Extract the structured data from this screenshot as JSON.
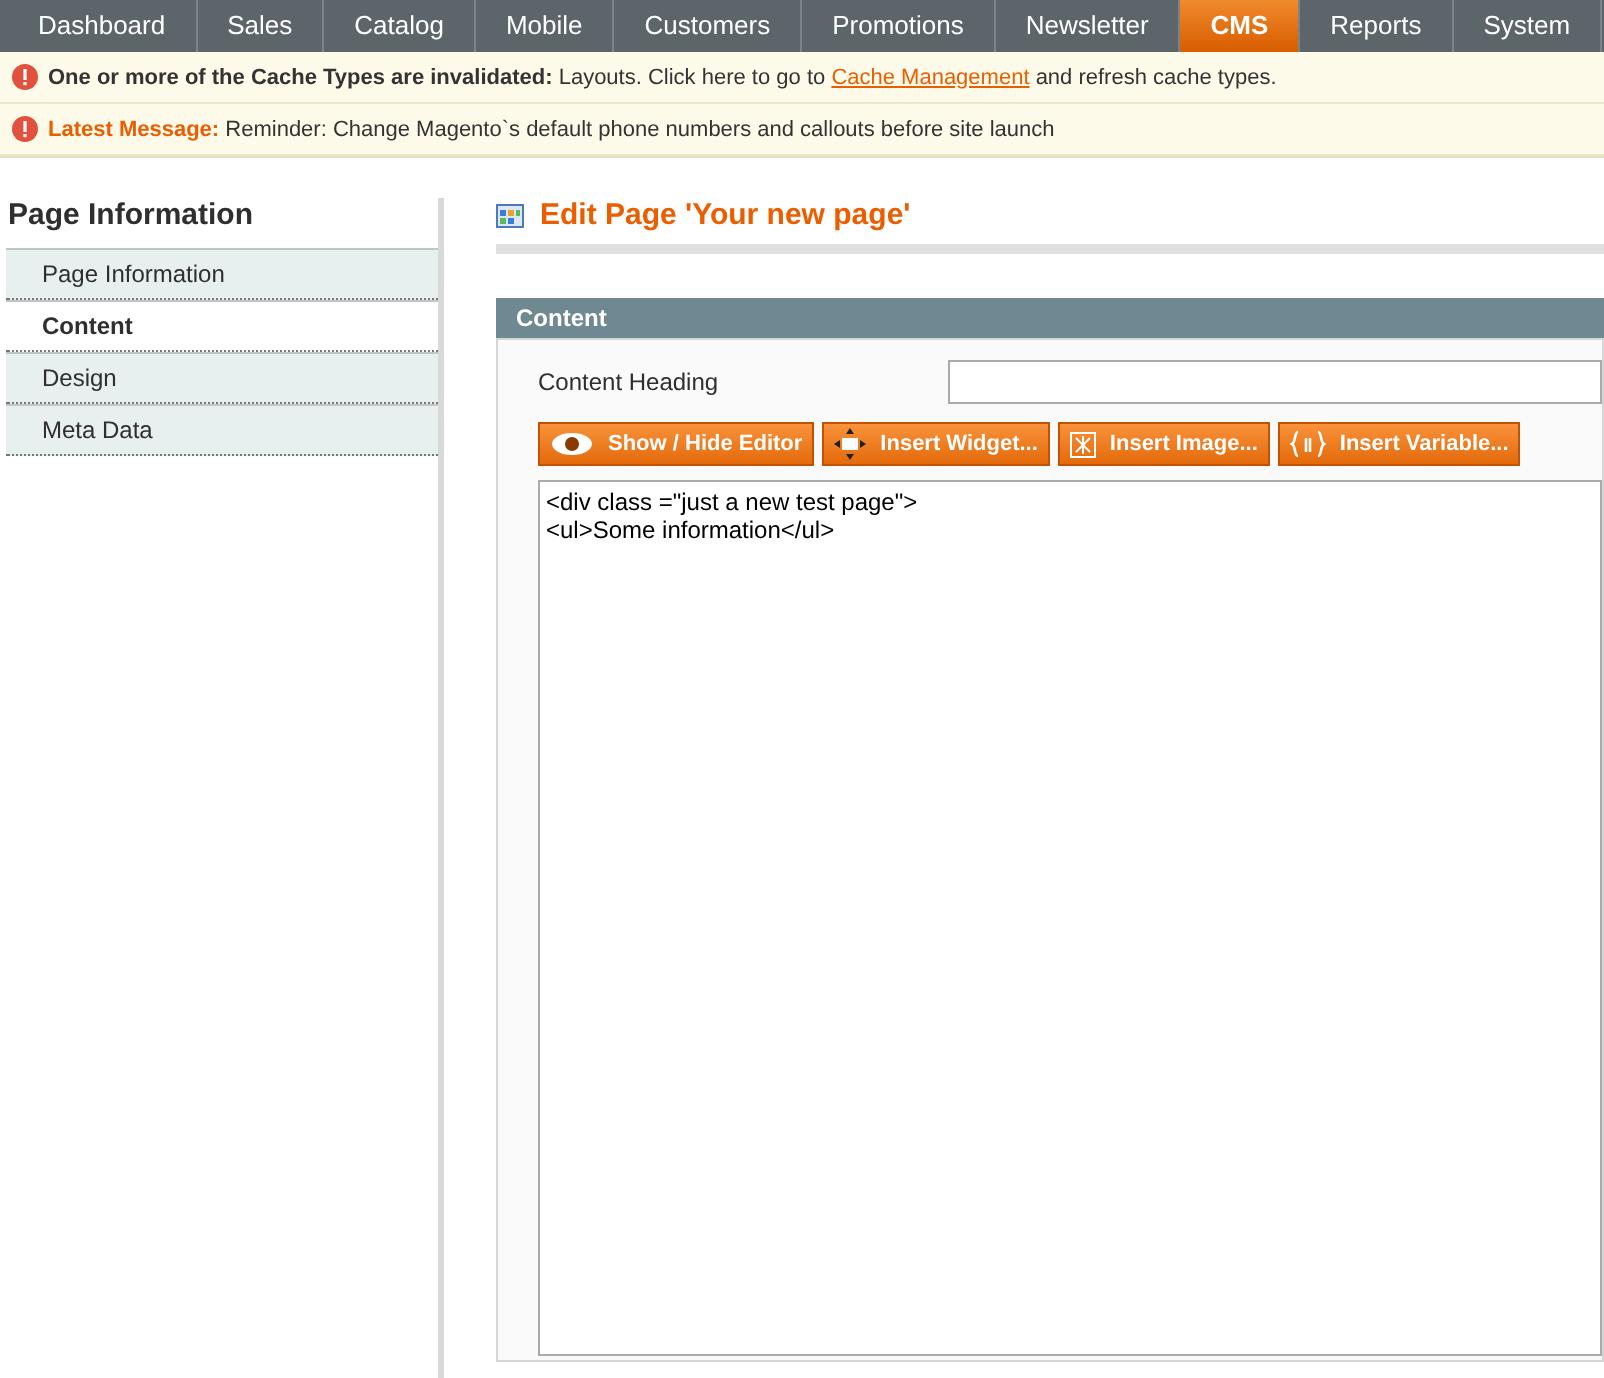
{
  "nav": [
    {
      "label": "Dashboard",
      "selected": false
    },
    {
      "label": "Sales",
      "selected": false
    },
    {
      "label": "Catalog",
      "selected": false
    },
    {
      "label": "Mobile",
      "selected": false
    },
    {
      "label": "Customers",
      "selected": false
    },
    {
      "label": "Promotions",
      "selected": false
    },
    {
      "label": "Newsletter",
      "selected": false
    },
    {
      "label": "CMS",
      "selected": true
    },
    {
      "label": "Reports",
      "selected": false
    },
    {
      "label": "System",
      "selected": false
    }
  ],
  "messages": [
    {
      "kind": "cache",
      "title": "One or more of the Cache Types are invalidated:",
      "text_before": "Layouts. Click here to go to",
      "link": "Cache Management",
      "text_after": "and refresh cache types."
    },
    {
      "kind": "latest",
      "title": "Latest Message:",
      "text_before": "Reminder: Change Magento`s default phone numbers and callouts before site launch"
    }
  ],
  "sidebar": {
    "title": "Page Information",
    "items": [
      {
        "label": "Page Information",
        "selected": false
      },
      {
        "label": "Content",
        "selected": true
      },
      {
        "label": "Design",
        "selected": false
      },
      {
        "label": "Meta Data",
        "selected": false
      }
    ]
  },
  "page_title": "Edit Page 'Your new page'",
  "section": {
    "title": "Content",
    "heading_label": "Content Heading",
    "buttons": [
      {
        "kind": "eye",
        "label": "Show / Hide Editor"
      },
      {
        "kind": "widget",
        "label": "Insert Widget..."
      },
      {
        "kind": "image",
        "label": "Insert Image..."
      },
      {
        "kind": "variable",
        "label": "Insert Variable..."
      }
    ],
    "editor_value": "<div class =\"just a new test page\">\n<ul>Some information</ul>"
  }
}
